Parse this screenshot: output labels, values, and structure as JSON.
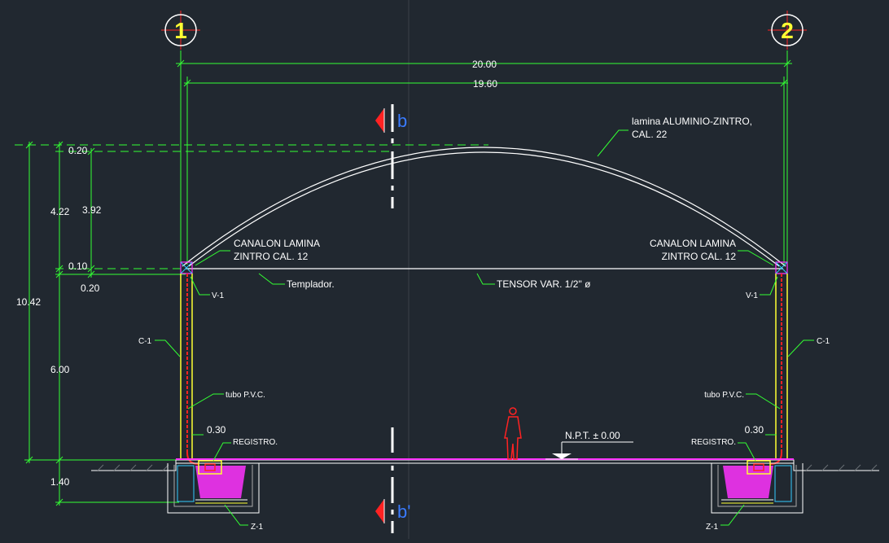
{
  "grid_axes": {
    "left": "1",
    "right": "2"
  },
  "dimensions": {
    "overall_width": "20.00",
    "inner_width": "19.60",
    "arch_offset": "0.20",
    "arch_rise": "4.22",
    "arch_rise_inner": "3.92",
    "canalon_offset_a": "0.10",
    "canalon_offset_b": "0.20",
    "total_height": "10.42",
    "column_height": "6.00",
    "foundation_depth": "1.40",
    "left_column_gap": "0.30",
    "right_column_gap": "0.30"
  },
  "annotations": {
    "roof_sheet_1": "lamina ALUMINIO-ZINTRO,",
    "roof_sheet_2": "CAL. 22",
    "gutter_left_1": "CANALON LAMINA",
    "gutter_left_2": "ZINTRO CAL. 12",
    "gutter_right_1": "CANALON LAMINA",
    "gutter_right_2": "ZINTRO CAL. 12",
    "templador": "Templador.",
    "tensor": "TENSOR VAR. 1/2\" ø",
    "v1_left": "V-1",
    "v1_right": "V-1",
    "c1_left": "C-1",
    "c1_right": "C-1",
    "pvc_left": "tubo P.V.C.",
    "pvc_right": "tubo P.V.C.",
    "registro_left": "REGISTRO.",
    "registro_right": "REGISTRO.",
    "npt": "N.P.T. ± 0.00",
    "z1_left": "Z-1",
    "z1_right": "Z-1",
    "section_top": "b",
    "section_bottom": "b'"
  },
  "colors": {
    "background": "#212830",
    "dimension": "#33ff33",
    "structure": "#ffffff",
    "column": "#ffff33",
    "pvc_pipe": "#ff2222",
    "slab": "#ff33ff",
    "section_marker": "#ff2222",
    "section_label": "#3a7bff"
  }
}
